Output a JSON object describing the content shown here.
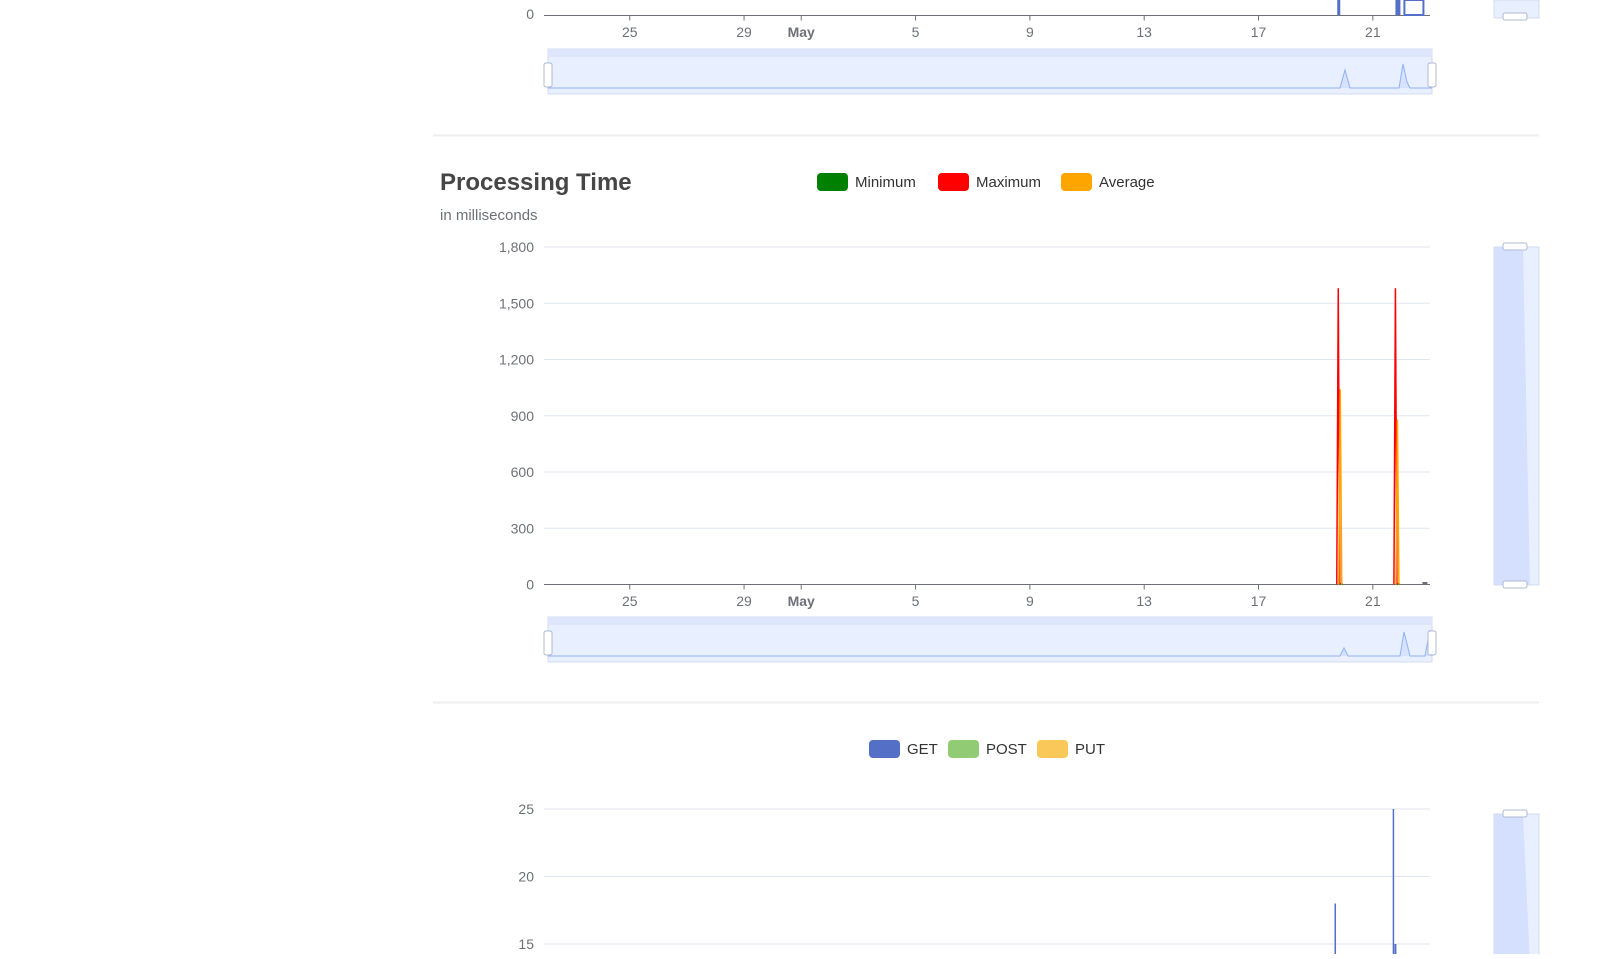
{
  "colors": {
    "minimum": "#008000",
    "maximum": "#ff0000",
    "average": "#ffa500",
    "get": "#5470c6",
    "post": "#91cc75",
    "put": "#fac858",
    "axis": "#6e7079",
    "grid": "#e0e6f1",
    "zoom_fill": "#e8efff",
    "zoom_border": "#d2dbee"
  },
  "top_chart": {
    "y_ticks": [
      "0"
    ],
    "x_ticks": [
      "25",
      "29",
      "May",
      "5",
      "9",
      "13",
      "17",
      "21"
    ]
  },
  "chart_data": [
    {
      "type": "bar",
      "title": "",
      "x_ticks": [
        "25",
        "29",
        "May",
        "5",
        "9",
        "13",
        "17",
        "21"
      ],
      "series": [
        {
          "values": [
            {
              "x": "May 20",
              "y": 9
            },
            {
              "x": "May 22",
              "y": 12
            }
          ]
        }
      ]
    },
    {
      "type": "line",
      "title": "Processing Time",
      "subtitle": "in milliseconds",
      "ylim": [
        0,
        1800
      ],
      "y_ticks": [
        "0",
        "300",
        "600",
        "900",
        "1,200",
        "1,500",
        "1,800"
      ],
      "x_ticks": [
        "25",
        "29",
        "May",
        "5",
        "9",
        "13",
        "17",
        "21"
      ],
      "legend": [
        "Minimum",
        "Maximum",
        "Average"
      ],
      "legend_position": "top-center",
      "series": [
        {
          "name": "Minimum",
          "values": [
            {
              "x": "May 20",
              "y": 5
            },
            {
              "x": "May 22",
              "y": 5
            }
          ]
        },
        {
          "name": "Maximum",
          "values": [
            {
              "x": "May 20",
              "y": 1580
            },
            {
              "x": "May 22",
              "y": 1580
            }
          ]
        },
        {
          "name": "Average",
          "values": [
            {
              "x": "May 20",
              "y": 1040
            },
            {
              "x": "May 22",
              "y": 880
            }
          ]
        }
      ]
    },
    {
      "type": "bar",
      "title": "",
      "y_ticks": [
        "15",
        "20",
        "25"
      ],
      "legend": [
        "GET",
        "POST",
        "PUT"
      ],
      "legend_position": "top-center",
      "series": [
        {
          "name": "GET",
          "values": [
            {
              "x": "May 20",
              "y": 18
            },
            {
              "x": "May 22",
              "y": 25
            }
          ]
        },
        {
          "name": "POST",
          "values": []
        },
        {
          "name": "PUT",
          "values": []
        }
      ]
    }
  ]
}
